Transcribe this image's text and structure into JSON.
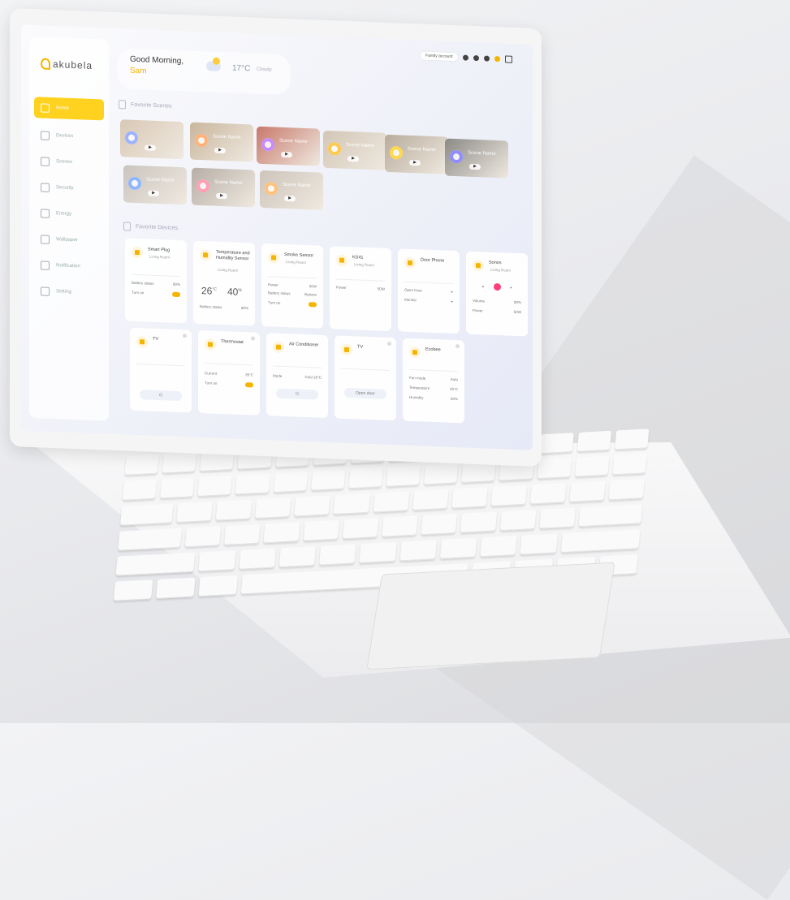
{
  "sidebar": {
    "logo": "akubela",
    "items": [
      {
        "label": "Home",
        "icon": "home-icon"
      },
      {
        "label": "Devices",
        "icon": "devices-icon"
      },
      {
        "label": "Scenes",
        "icon": "scenes-icon"
      },
      {
        "label": "Security",
        "icon": "shield-icon"
      },
      {
        "label": "Energy",
        "icon": "energy-icon"
      },
      {
        "label": "Wallpaper",
        "icon": "image-icon"
      },
      {
        "label": "Notification",
        "icon": "bell-icon"
      },
      {
        "label": "Setting",
        "icon": "gear-icon"
      }
    ],
    "active": "Home"
  },
  "header": {
    "greeting": "Good Morning,",
    "name": "Sam",
    "temperature": "17°C",
    "condition": "Cloudy",
    "account": "Family account"
  },
  "scenes": {
    "title": "Favorite Scenes",
    "items": [
      {
        "label": "",
        "color": "#d9c8b5"
      },
      {
        "label": "Scene Name",
        "color": "#c9b59c"
      },
      {
        "label": "Scene Name",
        "color": "#c7786a"
      },
      {
        "label": "Scene Name",
        "color": "#d2c6b6"
      },
      {
        "label": "Scene Name",
        "color": "#b8ac9c"
      },
      {
        "label": "Scene Name",
        "color": "#8c8a86"
      },
      {
        "label": "Scene Name",
        "color": "#c9c4bd"
      },
      {
        "label": "Scene Name",
        "color": "#b7aea6"
      },
      {
        "label": "Scene Name",
        "color": "#cdc4ba"
      }
    ]
  },
  "devices": {
    "title": "Favorite Devices",
    "smart_plug": {
      "name": "Smart Plug",
      "room": "Living Room",
      "battery_label": "Battery status",
      "battery": "80%",
      "turn_on": "Turn on"
    },
    "temp_sensor": {
      "name": "Temperature and Humidity Sensor",
      "room": "Living Room",
      "temp": "26",
      "temp_unit": "°C",
      "humidity": "40",
      "humidity_unit": "%",
      "battery_label": "Battery status",
      "battery": "80%"
    },
    "smoke": {
      "name": "Smoke Sensor",
      "room": "Living Room",
      "power_label": "Power",
      "power": "50W",
      "battery_label": "Battery status",
      "battery": "Bypass",
      "turn_on": "Turn on"
    },
    "ks41": {
      "name": "KS41",
      "room": "Living Room",
      "power_label": "Power",
      "power": "50W"
    },
    "door_phone": {
      "name": "Door Phone",
      "open_door": "Open Door",
      "monitor": "Monitor"
    },
    "sonos": {
      "name": "Sonos",
      "room": "Living Room",
      "volume_label": "Volume",
      "volume": "80%",
      "power_label": "Power",
      "power": "50W"
    },
    "tv1": {
      "name": "TV"
    },
    "thermostat": {
      "name": "Thermostat",
      "current_label": "Current",
      "current": "26°C",
      "turn_on": "Turn on"
    },
    "ac": {
      "name": "Air Conditioner",
      "mode_label": "Mode",
      "mode": "Cold 16°C"
    },
    "tv2": {
      "name": "TV",
      "open_door": "Open door"
    },
    "ecobee": {
      "name": "Ecobee",
      "fan_label": "Fan mode",
      "fan": "Auto",
      "temp_label": "Temperature",
      "temp": "26°C",
      "humidity_label": "Humidity",
      "humidity": "60%"
    }
  }
}
